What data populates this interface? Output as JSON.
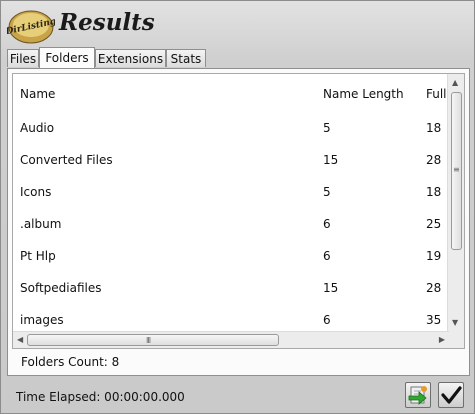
{
  "window": {
    "title": "Results",
    "logo_text": "DirListing"
  },
  "tabs": [
    {
      "label": "Files"
    },
    {
      "label": "Folders"
    },
    {
      "label": "Extensions"
    },
    {
      "label": "Stats"
    }
  ],
  "active_tab": "Folders",
  "table": {
    "columns": [
      "Name",
      "Name Length",
      "Full"
    ],
    "rows": [
      {
        "name": "Audio",
        "length": "5",
        "full": "18"
      },
      {
        "name": "Converted Files",
        "length": "15",
        "full": "28"
      },
      {
        "name": "Icons",
        "length": "5",
        "full": "18"
      },
      {
        "name": ".album",
        "length": "6",
        "full": "25"
      },
      {
        "name": "Pt Hlp",
        "length": "6",
        "full": "19"
      },
      {
        "name": "Softpediafiles",
        "length": "15",
        "full": "28"
      },
      {
        "name": "images",
        "length": "6",
        "full": "35"
      }
    ]
  },
  "footer": {
    "folders_count": "Folders Count: 8",
    "time_elapsed": "Time Elapsed: 00:00:00.000"
  },
  "icons": {
    "export": "export-arrow-icon",
    "ok": "checkmark-icon",
    "vscroll_grip": "≡",
    "hscroll_grip": "III"
  }
}
